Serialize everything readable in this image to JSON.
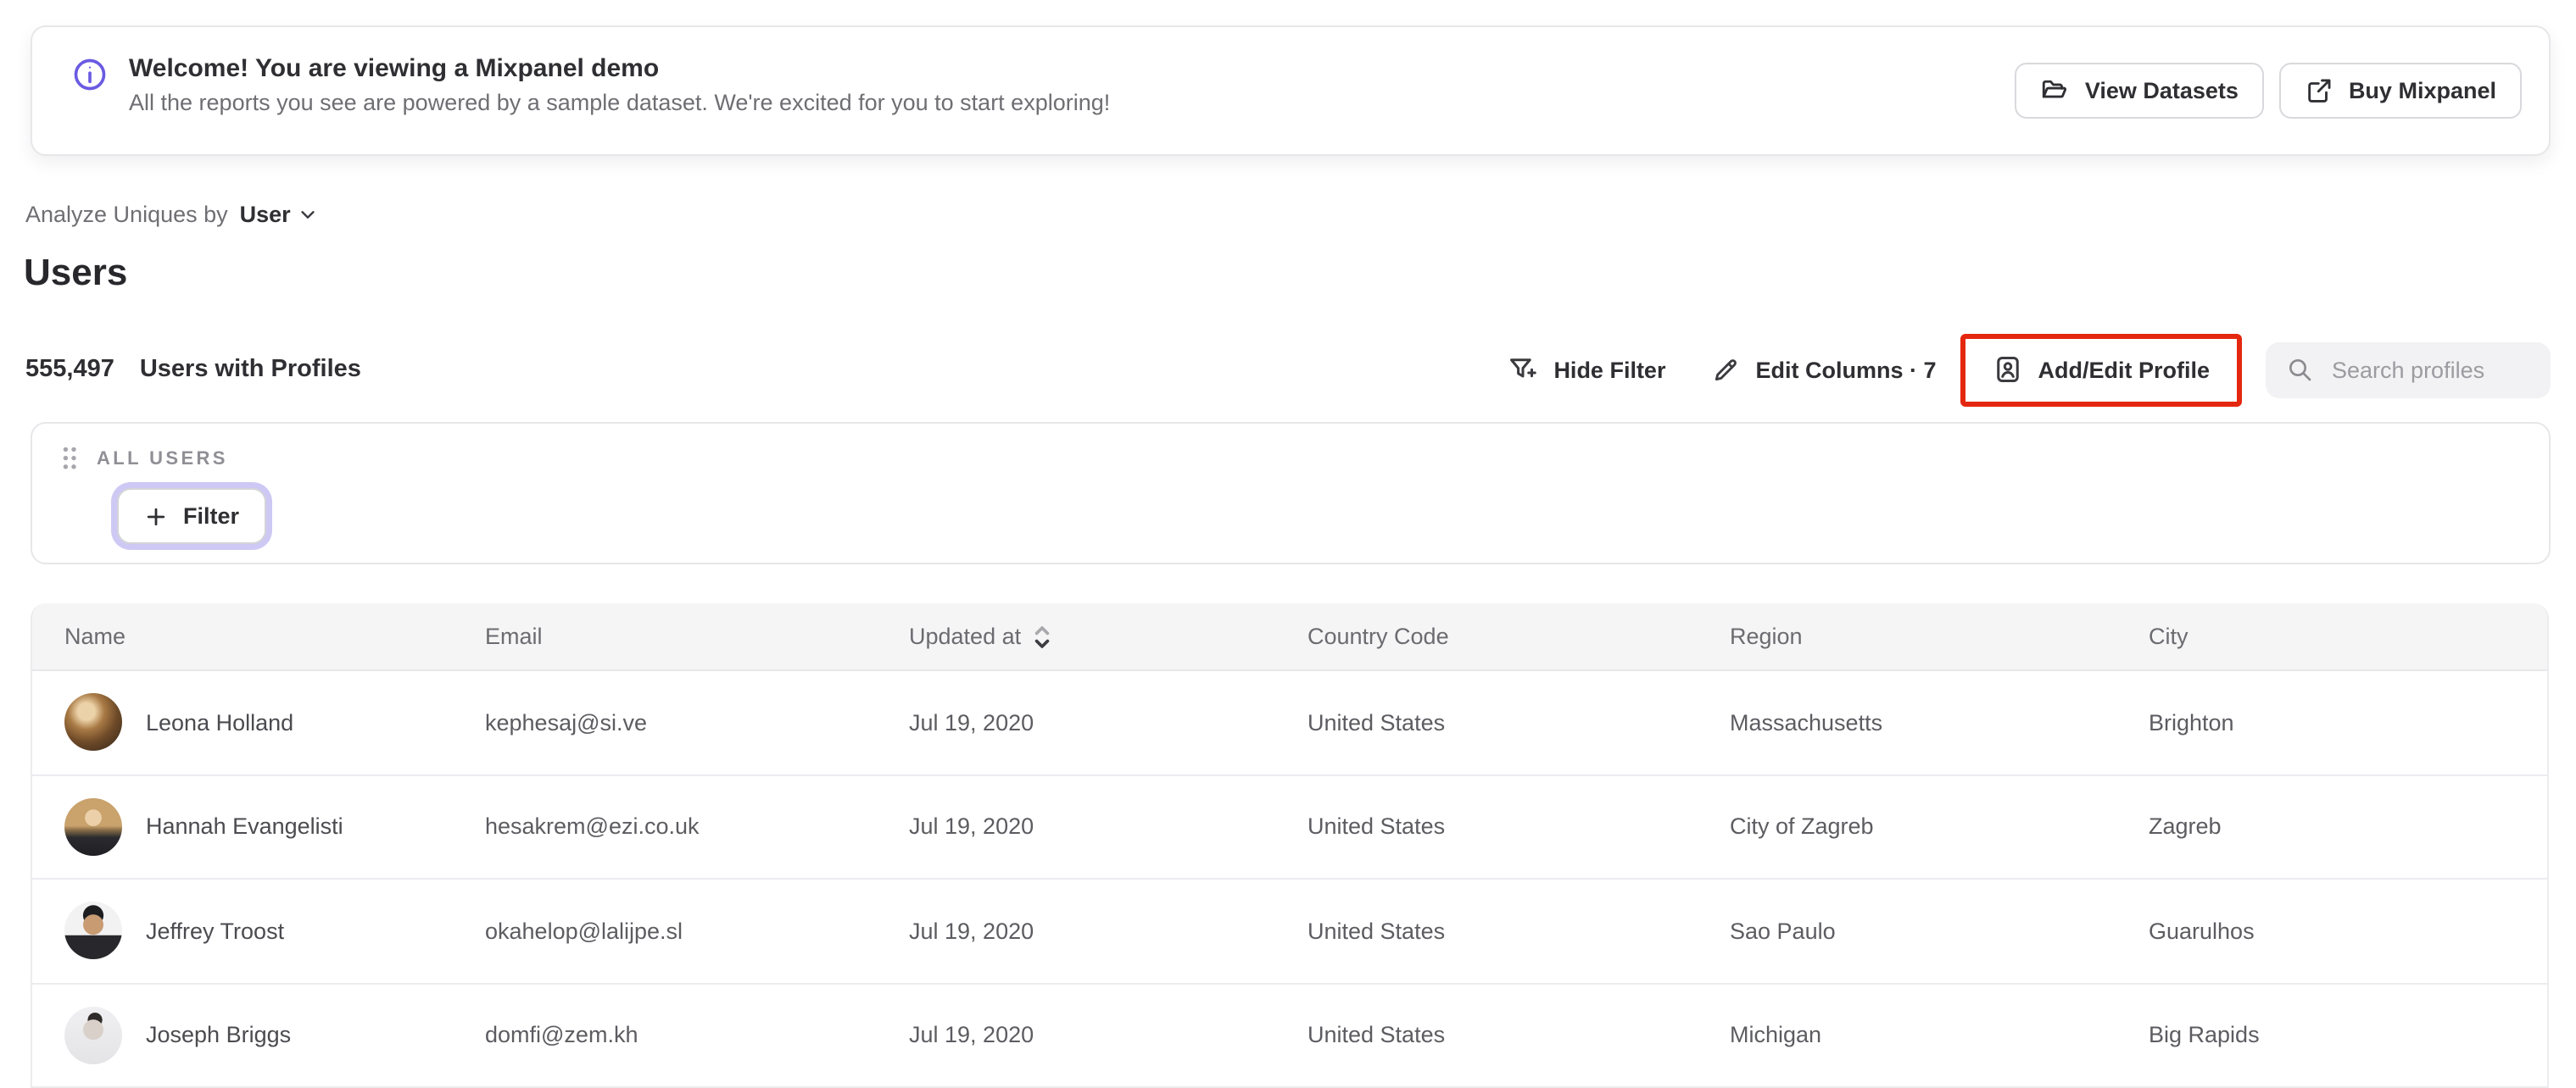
{
  "banner": {
    "title": "Welcome! You are viewing a Mixpanel demo",
    "subtitle": "All the reports you see are powered by a sample dataset. We're excited for you to start exploring!",
    "view_datasets_label": "View Datasets",
    "buy_mixpanel_label": "Buy Mixpanel"
  },
  "controls": {
    "analyze_label": "Analyze Uniques by",
    "analyze_value": "User",
    "page_title": "Users",
    "count": "555,497",
    "count_label": "Users with Profiles",
    "hide_filter_label": "Hide Filter",
    "edit_columns_label": "Edit Columns · 7",
    "add_edit_profile_label": "Add/Edit Profile",
    "search_placeholder": "Search profiles"
  },
  "filter_card": {
    "group_label": "ALL USERS",
    "filter_label": "Filter"
  },
  "table": {
    "columns": [
      "Name",
      "Email",
      "Updated at",
      "Country Code",
      "Region",
      "City"
    ],
    "rows": [
      {
        "name": "Leona Holland",
        "email": "kephesaj@si.ve",
        "updated_at": "Jul 19, 2020",
        "country_code": "United States",
        "region": "Massachusetts",
        "city": "Brighton"
      },
      {
        "name": "Hannah Evangelisti",
        "email": "hesakrem@ezi.co.uk",
        "updated_at": "Jul 19, 2020",
        "country_code": "United States",
        "region": "City of Zagreb",
        "city": "Zagreb"
      },
      {
        "name": "Jeffrey Troost",
        "email": "okahelop@lalijpe.sl",
        "updated_at": "Jul 19, 2020",
        "country_code": "United States",
        "region": "Sao Paulo",
        "city": "Guarulhos"
      },
      {
        "name": "Joseph Briggs",
        "email": "domfi@zem.kh",
        "updated_at": "Jul 19, 2020",
        "country_code": "United States",
        "region": "Michigan",
        "city": "Big Rapids"
      }
    ]
  },
  "icons": {
    "info-icon": "circled letter i",
    "folder-icon": "open folder outline",
    "external-link-icon": "box with outward arrow",
    "filter-plus-icon": "funnel with plus sign",
    "pencil-icon": "pencil",
    "profile-card-icon": "person inside rounded card",
    "search-icon": "magnifying glass",
    "drag-handle-icon": "six-dot grip",
    "plus-icon": "plus sign",
    "chevron-down-icon": "downward chevron",
    "sort-icon": "stacked up and down chevrons"
  },
  "colors": {
    "accent_purple": "#6a5be2",
    "annotation_red": "#e4270f",
    "filter_focus_ring": "#cdc9f4",
    "text_dark": "#2f2f33",
    "text_gray": "#6e6e73",
    "header_bg": "#f5f5f6"
  }
}
